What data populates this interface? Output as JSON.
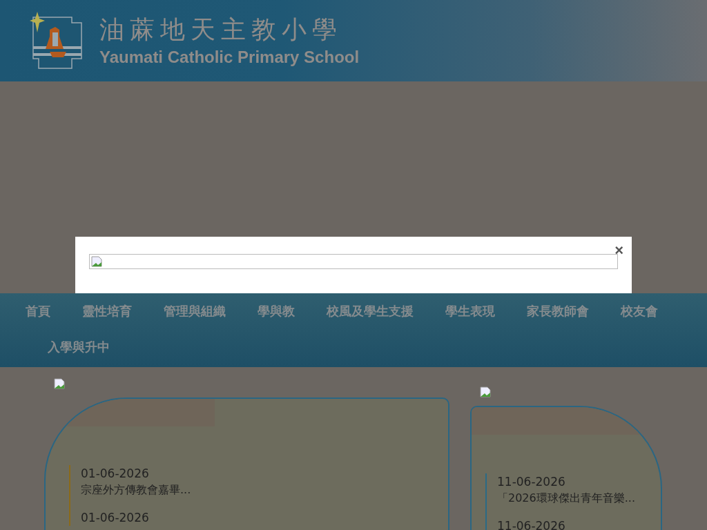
{
  "header": {
    "title_zh": "油蔴地天主教小學",
    "title_en": "Yaumati Catholic Primary School"
  },
  "modal": {
    "close": "×"
  },
  "nav": [
    {
      "label": "首頁"
    },
    {
      "label": "靈性培育"
    },
    {
      "label": "管理與組織"
    },
    {
      "label": "學與教"
    },
    {
      "label": "校風及學生支援"
    },
    {
      "label": "學生表現"
    },
    {
      "label": "家長教師會"
    },
    {
      "label": "校友會"
    },
    {
      "label": "入學與升中"
    }
  ],
  "panels": [
    {
      "color": "#8a6a1a",
      "items": [
        {
          "date": "01-06-2026",
          "title": "宗座外方傳教會嘉畢..."
        },
        {
          "date": "01-06-2026"
        }
      ]
    },
    {
      "color": "#2a6a86",
      "items": [
        {
          "date": "11-06-2026",
          "title": "「2026環球傑出青年音樂..."
        },
        {
          "date": "11-06-2026"
        }
      ]
    }
  ]
}
